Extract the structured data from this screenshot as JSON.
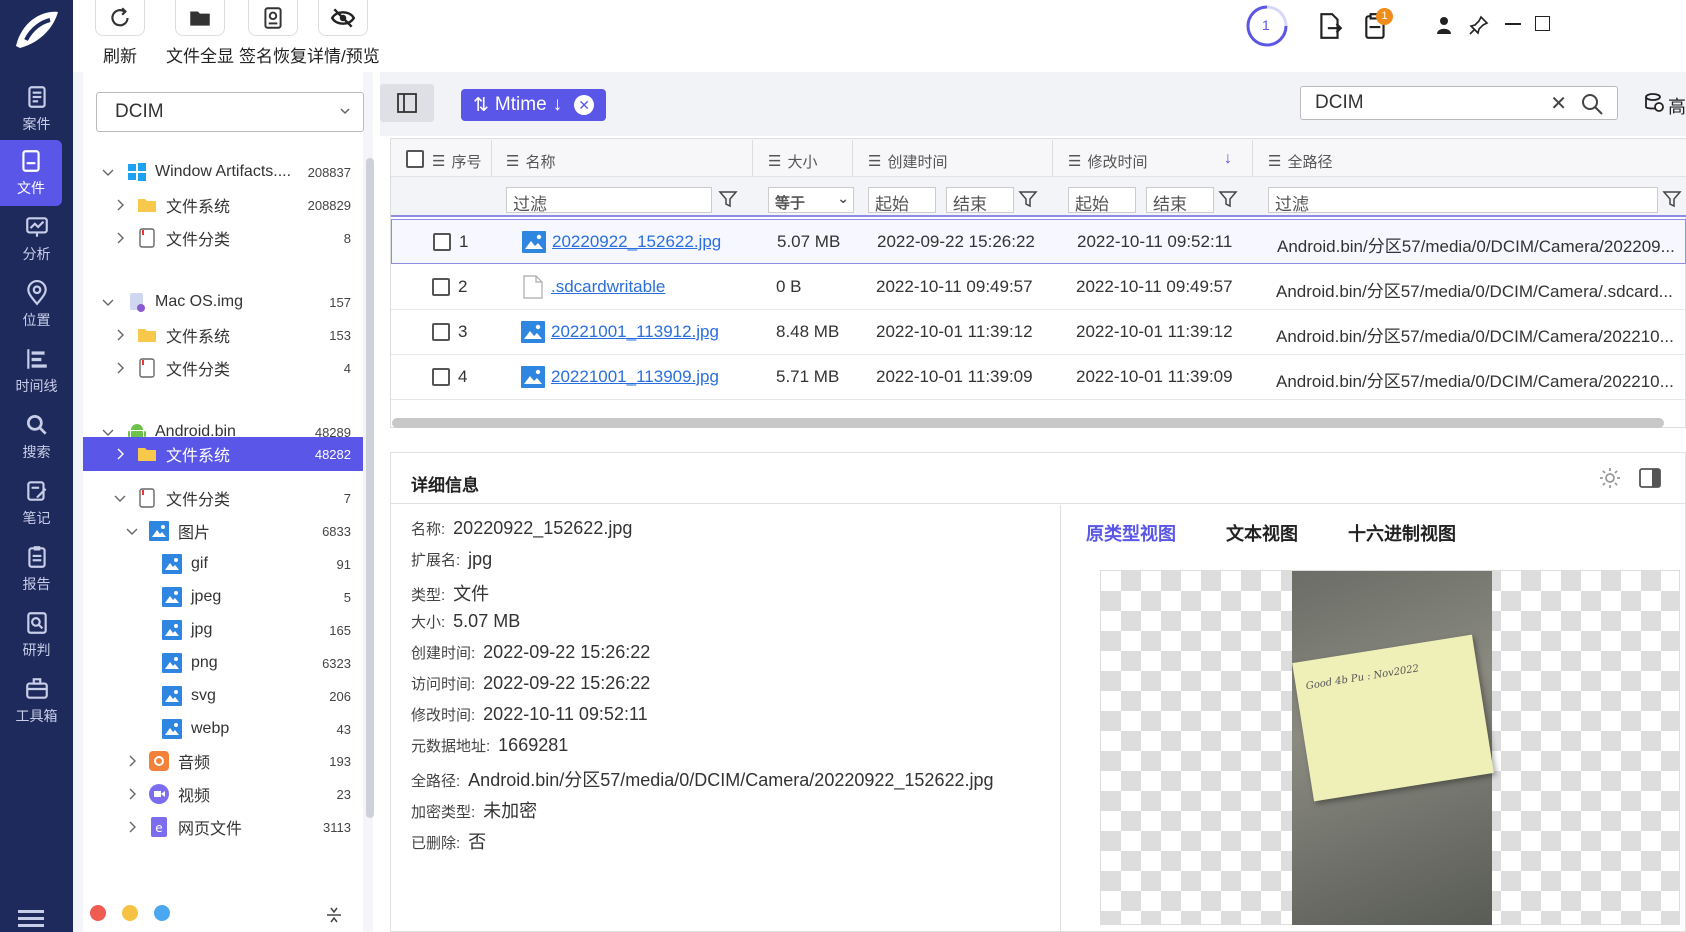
{
  "nav": {
    "items": [
      {
        "label": "案件",
        "icon": "case-icon"
      },
      {
        "label": "文件",
        "icon": "file-icon"
      },
      {
        "label": "分析",
        "icon": "analysis-icon"
      },
      {
        "label": "位置",
        "icon": "location-icon"
      },
      {
        "label": "时间线",
        "icon": "timeline-icon"
      },
      {
        "label": "搜索",
        "icon": "search-icon"
      },
      {
        "label": "笔记",
        "icon": "note-icon"
      },
      {
        "label": "报告",
        "icon": "report-icon"
      },
      {
        "label": "研判",
        "icon": "judge-icon"
      },
      {
        "label": "工具箱",
        "icon": "toolbox-icon"
      }
    ],
    "active_index": 1
  },
  "toolbar": {
    "refresh": "刷新",
    "show_all_files": "文件全显",
    "signature_recovery": "签名恢复",
    "detail_preview": "详情/预览",
    "task_count": "1",
    "notification_badge": "1"
  },
  "tree": {
    "dropdown_value": "DCIM",
    "nodes": [
      {
        "label": "Window Artifacts....",
        "count": "208837"
      },
      {
        "label": "文件系统",
        "count": "208829"
      },
      {
        "label": "文件分类",
        "count": "8"
      },
      {
        "label": "Mac OS.img",
        "count": "157"
      },
      {
        "label": "文件系统",
        "count": "153"
      },
      {
        "label": "文件分类",
        "count": "4"
      },
      {
        "label": "Android.bin",
        "count": "48289"
      },
      {
        "label": "文件系统",
        "count": "48282"
      },
      {
        "label": "文件分类",
        "count": "7"
      },
      {
        "label": "图片",
        "count": "6833"
      },
      {
        "label": "gif",
        "count": "91"
      },
      {
        "label": "jpeg",
        "count": "5"
      },
      {
        "label": "jpg",
        "count": "165"
      },
      {
        "label": "png",
        "count": "6323"
      },
      {
        "label": "svg",
        "count": "206"
      },
      {
        "label": "webp",
        "count": "43"
      },
      {
        "label": "音频",
        "count": "193"
      },
      {
        "label": "视频",
        "count": "23"
      },
      {
        "label": "网页文件",
        "count": "3113"
      }
    ]
  },
  "filterbar": {
    "sort_label": "Mtime",
    "search_value": "DCIM",
    "advanced_label": "高"
  },
  "table": {
    "headers": {
      "index": "序号",
      "name": "名称",
      "size": "大小",
      "created": "创建时间",
      "modified": "修改时间",
      "path": "全路径"
    },
    "filters": {
      "name": "过滤",
      "size_op": "等于",
      "created_start": "起始",
      "created_end": "结束",
      "modified_start": "起始",
      "modified_end": "结束",
      "path": "过滤"
    },
    "rows": [
      {
        "idx": "1",
        "name": "20220922_152622.jpg",
        "size": "5.07 MB",
        "created": "2022-09-22 15:26:22",
        "modified": "2022-10-11 09:52:11",
        "path": "Android.bin/分区57/media/0/DCIM/Camera/202209..."
      },
      {
        "idx": "2",
        "name": ".sdcardwritable",
        "size": "0 B",
        "created": "2022-10-11 09:49:57",
        "modified": "2022-10-11 09:49:57",
        "path": "Android.bin/分区57/media/0/DCIM/Camera/.sdcard..."
      },
      {
        "idx": "3",
        "name": "20221001_113912.jpg",
        "size": "8.48 MB",
        "created": "2022-10-01 11:39:12",
        "modified": "2022-10-01 11:39:12",
        "path": "Android.bin/分区57/media/0/DCIM/Camera/202210..."
      },
      {
        "idx": "4",
        "name": "20221001_113909.jpg",
        "size": "5.71 MB",
        "created": "2022-10-01 11:39:09",
        "modified": "2022-10-01 11:39:09",
        "path": "Android.bin/分区57/media/0/DCIM/Camera/202210..."
      }
    ]
  },
  "detail": {
    "title": "详细信息",
    "fields": [
      {
        "k": "名称:",
        "v": "20220922_152622.jpg"
      },
      {
        "k": "扩展名:",
        "v": "jpg"
      },
      {
        "k": "类型:",
        "v": "文件"
      },
      {
        "k": "大小:",
        "v": "5.07 MB"
      },
      {
        "k": "创建时间:",
        "v": "2022-09-22 15:26:22"
      },
      {
        "k": "访问时间:",
        "v": "2022-09-22 15:26:22"
      },
      {
        "k": "修改时间:",
        "v": "2022-10-11 09:52:11"
      },
      {
        "k": "元数据地址:",
        "v": "1669281"
      },
      {
        "k": "全路径:",
        "v": "Android.bin/分区57/media/0/DCIM/Camera/20220922_152622.jpg"
      },
      {
        "k": "加密类型:",
        "v": "未加密"
      },
      {
        "k": "已删除:",
        "v": "否"
      }
    ],
    "tabs": [
      "原类型视图",
      "文本视图",
      "十六进制视图"
    ],
    "note_text": "Good 4b Pu : Nov2022"
  },
  "colors": {
    "accent": "#5a56e8",
    "nav_bg": "#1f2a5c",
    "link": "#2a6fe0",
    "badge": "#f08c1a"
  }
}
